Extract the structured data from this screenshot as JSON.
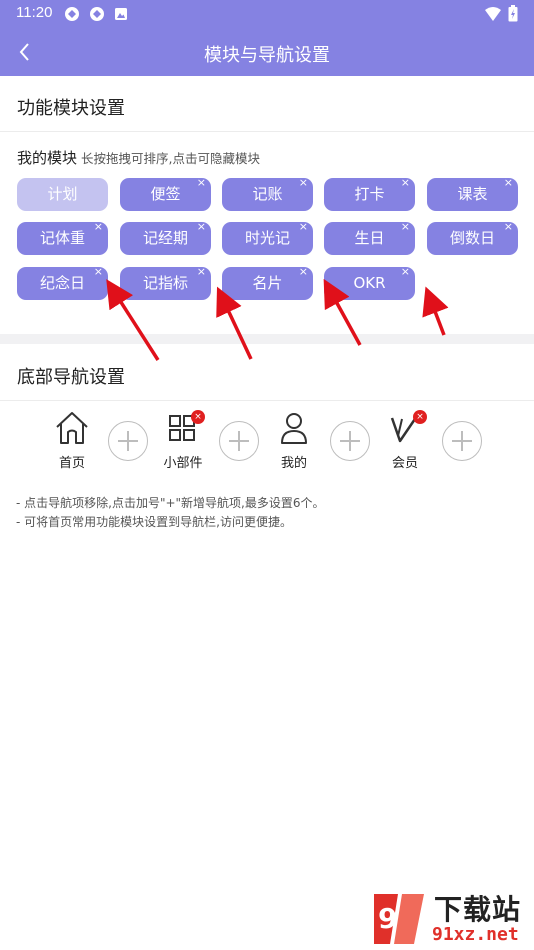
{
  "status_bar": {
    "time": "11:20"
  },
  "header": {
    "title": "模块与导航设置"
  },
  "modules_section": {
    "title": "功能模块设置",
    "my_modules_label": "我的模块",
    "hint": "长按拖拽可排序,点击可隐藏模块",
    "chips": [
      {
        "label": "计划",
        "removable": false,
        "state": "disabled"
      },
      {
        "label": "便签",
        "removable": true
      },
      {
        "label": "记账",
        "removable": true
      },
      {
        "label": "打卡",
        "removable": true
      },
      {
        "label": "课表",
        "removable": true
      },
      {
        "label": "记体重",
        "removable": true
      },
      {
        "label": "记经期",
        "removable": true
      },
      {
        "label": "时光记",
        "removable": true
      },
      {
        "label": "生日",
        "removable": true
      },
      {
        "label": "倒数日",
        "removable": true
      },
      {
        "label": "纪念日",
        "removable": true
      },
      {
        "label": "记指标",
        "removable": true
      },
      {
        "label": "名片",
        "removable": true
      },
      {
        "label": "OKR",
        "removable": true
      }
    ],
    "remove_glyph": "×"
  },
  "nav_section": {
    "title": "底部导航设置",
    "items": [
      {
        "label": "首页",
        "icon": "home-icon",
        "removable": false
      },
      {
        "label": "小部件",
        "icon": "grid-icon",
        "removable": true
      },
      {
        "label": "我的",
        "icon": "user-icon",
        "removable": false
      },
      {
        "label": "会员",
        "icon": "vip-icon",
        "removable": true
      }
    ],
    "badge_glyph": "×",
    "notes": [
      "- 点击导航项移除,点击加号\"+\"新增导航项,最多设置6个。",
      "- 可将首页常用功能模块设置到导航栏,访问更便捷。"
    ]
  },
  "watermark": {
    "title": "下载站",
    "url": "91xz.net"
  },
  "colors": {
    "accent": "#8582e2",
    "accent_disabled": "#c4c3f0",
    "badge": "#e02020",
    "arrow": "#e0101a"
  }
}
